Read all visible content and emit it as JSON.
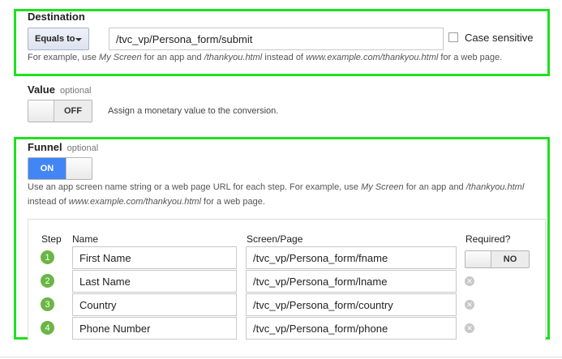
{
  "destination": {
    "title": "Destination",
    "match_type": "Equals to",
    "value": "/tvc_vp/Persona_form/submit",
    "case_sensitive_label": "Case sensitive",
    "hint_parts": [
      "For example, use ",
      "My Screen",
      " for an app and ",
      "/thankyou.html",
      " instead of ",
      "www.example.com/thankyou.html",
      " for a web page."
    ]
  },
  "value_section": {
    "title": "Value",
    "optional": "optional",
    "toggle_state": "OFF",
    "description": "Assign a monetary value to the conversion."
  },
  "funnel": {
    "title": "Funnel",
    "optional": "optional",
    "toggle_state": "ON",
    "hint_line1_parts": [
      "Use an app screen name string or a web page URL for each step. For example, use ",
      "My Screen",
      " for an app and ",
      "/thankyou.html"
    ],
    "hint_line2_parts": [
      "instead of ",
      "www.example.com/thankyou.html",
      " for a web page."
    ],
    "headers": {
      "step": "Step",
      "name": "Name",
      "screen": "Screen/Page",
      "required": "Required?"
    },
    "required_toggle": "NO",
    "steps": [
      {
        "num": "1",
        "name": "First Name",
        "screen": "/tvc_vp/Persona_form/fname"
      },
      {
        "num": "2",
        "name": "Last Name",
        "screen": "/tvc_vp/Persona_form/lname"
      },
      {
        "num": "3",
        "name": "Country",
        "screen": "/tvc_vp/Persona_form/country"
      },
      {
        "num": "4",
        "name": "Phone Number",
        "screen": "/tvc_vp/Persona_form/phone"
      }
    ]
  },
  "colors": {
    "highlight": "#1fe01f",
    "toggle_on": "#4285f4",
    "step_circle": "#6bb545"
  },
  "icons": {
    "remove": "close-circle-icon",
    "dropdown": "chevron-down-icon"
  }
}
